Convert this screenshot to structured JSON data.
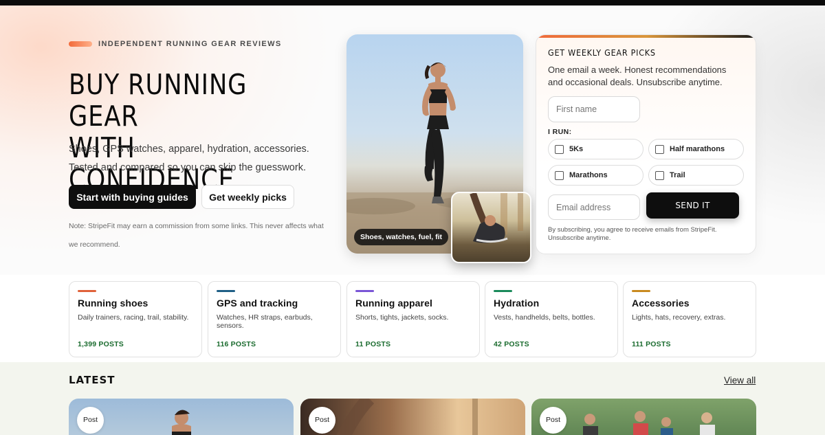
{
  "hero": {
    "eyebrow": "INDEPENDENT RUNNING GEAR REVIEWS",
    "title_line1": "BUY RUNNING GEAR",
    "title_line2": "WITH CONFIDENCE.",
    "subtitle": "Shoes, GPS watches, apparel, hydration, accessories. Tested and compared so you can skip the guesswork.",
    "primary_button": "Start with buying guides",
    "secondary_button": "Get weekly picks",
    "note": "Note: StripeFit may earn a commission from some links. This never affects what we recommend.",
    "photo_tag": "Shoes, watches, fuel, fit"
  },
  "signup": {
    "title": "GET WEEKLY GEAR PICKS",
    "description": "One email a week. Honest recommendations and occasional deals. Unsubscribe anytime.",
    "first_name_placeholder": "First name",
    "i_run_label": "I RUN:",
    "options": [
      "5Ks",
      "Half marathons",
      "Marathons",
      "Trail"
    ],
    "email_placeholder": "Email address",
    "send_button": "SEND IT",
    "legal": "By subscribing, you agree to receive emails from StripeFit. Unsubscribe anytime."
  },
  "categories": [
    {
      "title": "Running shoes",
      "desc": "Daily trainers, racing, trail, stability.",
      "count": "1,399 POSTS",
      "color": "#e0623a"
    },
    {
      "title": "GPS and tracking",
      "desc": "Watches, HR straps, earbuds, sensors.",
      "count": "116 POSTS",
      "color": "#1f5f86"
    },
    {
      "title": "Running apparel",
      "desc": "Shorts, tights, jackets, socks.",
      "count": "11 POSTS",
      "color": "#7a55d6"
    },
    {
      "title": "Hydration",
      "desc": "Vests, handhelds, belts, bottles.",
      "count": "42 POSTS",
      "color": "#1a8a5a"
    },
    {
      "title": "Accessories",
      "desc": "Lights, hats, recovery, extras.",
      "count": "111 POSTS",
      "color": "#c98a1f"
    }
  ],
  "latest": {
    "title": "LATEST",
    "view_all": "View all",
    "posts": [
      {
        "badge": "Post"
      },
      {
        "badge": "Post"
      },
      {
        "badge": "Post"
      }
    ]
  }
}
